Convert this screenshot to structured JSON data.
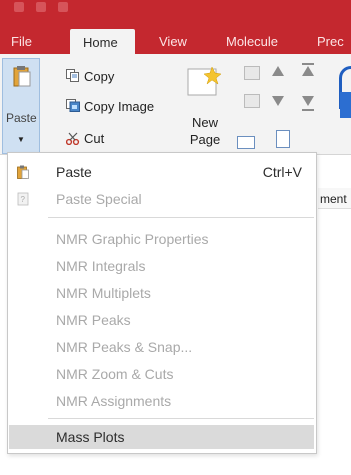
{
  "tabs": [
    {
      "label": "File"
    },
    {
      "label": "Home",
      "active": true
    },
    {
      "label": "View"
    },
    {
      "label": "Molecule"
    },
    {
      "label": "Prec"
    }
  ],
  "ribbon": {
    "paste_label": "Paste",
    "copy_label": "Copy",
    "copy_image_label": "Copy Image",
    "cut_label": "Cut",
    "new_page_label_1": "New",
    "new_page_label_2": "Page",
    "paste_icon": "clipboard-icon",
    "copy_icon": "copy-icon",
    "copy_image_icon": "copy-image-icon",
    "cut_icon": "scissors-icon"
  },
  "side_panel": {
    "label": "ment"
  },
  "paste_menu": {
    "items": [
      {
        "label": "Paste",
        "shortcut": "Ctrl+V",
        "icon": "clipboard-icon",
        "enabled": true
      },
      {
        "label": "Paste Special",
        "shortcut": "",
        "icon": "paste-special-icon",
        "enabled": false
      },
      {
        "label": "NMR Graphic Properties",
        "enabled": false
      },
      {
        "label": "NMR Integrals",
        "enabled": false
      },
      {
        "label": "NMR Multiplets",
        "enabled": false
      },
      {
        "label": "NMR Peaks",
        "enabled": false
      },
      {
        "label": "NMR Peaks & Snap...",
        "enabled": false
      },
      {
        "label": "NMR Zoom & Cuts",
        "enabled": false
      },
      {
        "label": "NMR Assignments",
        "enabled": false
      },
      {
        "label": "Mass Plots",
        "enabled": true,
        "highlighted": true
      }
    ]
  },
  "colors": {
    "ribbon_red": "#c4282f",
    "ribbon_bg": "#f3f3f3",
    "highlight": "#dadada",
    "disabled_text": "#a9a9a9",
    "accent_blue": "#2c6ed1"
  }
}
